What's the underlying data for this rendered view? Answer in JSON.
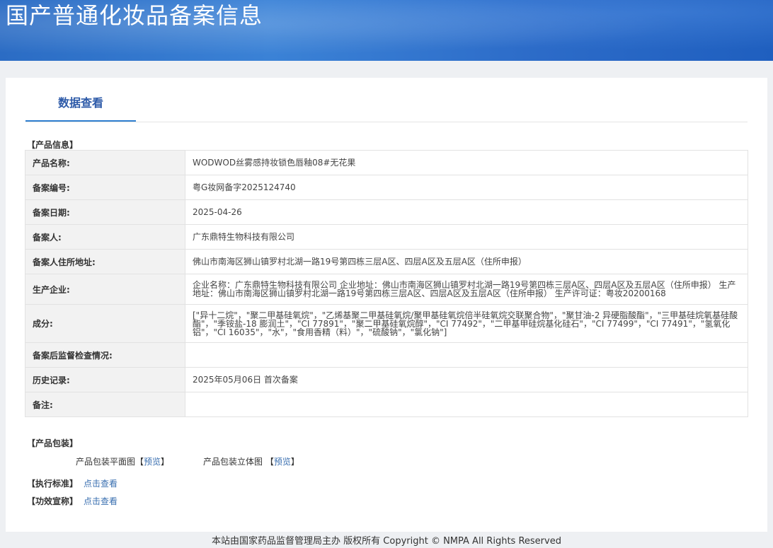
{
  "header": {
    "title": "国产普通化妆品备案信息"
  },
  "tabs": {
    "active_label": "数据查看"
  },
  "product_section": {
    "title": "【产品信息】"
  },
  "product_info": [
    {
      "label": "产品名称:",
      "value": "WODWOD丝雾感持妆锁色唇釉08#无花果"
    },
    {
      "label": "备案编号:",
      "value": "粤G妆网备字2025124740"
    },
    {
      "label": "备案日期:",
      "value": "2025-04-26"
    },
    {
      "label": "备案人:",
      "value": "广东鼎特生物科技有限公司"
    },
    {
      "label": "备案人住所地址:",
      "value": "佛山市南海区狮山镇罗村北湖一路19号第四栋三层A区、四层A区及五层A区（住所申报）"
    },
    {
      "label": "生产企业:",
      "value": "企业名称：广东鼎特生物科技有限公司 企业地址：佛山市南海区狮山镇罗村北湖一路19号第四栋三层A区、四层A区及五层A区（住所申报） 生产地址：佛山市南海区狮山镇罗村北湖一路19号第四栋三层A区、四层A区及五层A区（住所申报） 生产许可证：粤妆20200168"
    },
    {
      "label": "成分:",
      "value": "[\"异十二烷\"，\"聚二甲基硅氧烷\"，\"乙烯基聚二甲基硅氧烷/聚甲基硅氧烷倍半硅氧烷交联聚合物\"，\"聚甘油-2 异硬脂酸酯\"，\"三甲基硅烷氧基硅酸酯\"，\"季铵盐-18 膨润土\"，\"CI 77891\"，\"聚二甲基硅氧烷醇\"，\"CI 77492\"，\"二甲基甲硅烷基化硅石\"，\"CI 77499\"，\"CI 77491\"，\"氢氧化铝\"，\"CI 16035\"，\"水\"，\"食用香精（料）\"，\"硫酸钠\"，\"氯化钠\"]"
    },
    {
      "label": "备案后监督检查情况:",
      "value": ""
    },
    {
      "label": "历史记录:",
      "value": "2025年05月06日 首次备案"
    },
    {
      "label": "备注:",
      "value": ""
    }
  ],
  "packaging": {
    "title": "【产品包装】",
    "flat_label": "产品包装平面图",
    "three_d_label": "产品包装立体图",
    "preview_link": "预览",
    "bracket_open": "【",
    "bracket_close": "】"
  },
  "standards": {
    "label": "【执行标准】",
    "link": "点击查看"
  },
  "efficacy": {
    "label": "【功效宣称】",
    "link": "点击查看"
  },
  "footer": {
    "text": "本站由国家药品监督管理局主办 版权所有 Copyright © NMPA All Rights Reserved"
  }
}
